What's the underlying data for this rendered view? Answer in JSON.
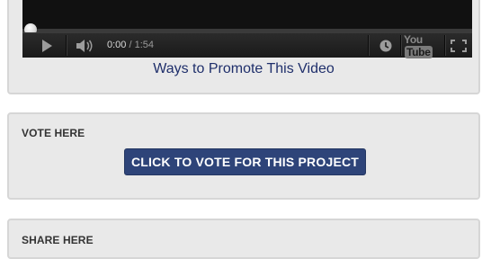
{
  "video": {
    "current_time": "0:00",
    "separator": "/",
    "duration": "1:54",
    "progress_fraction": 0.0,
    "title": "Ways to Promote This Video",
    "logo_text_left": "You",
    "logo_text_right": "Tube",
    "icons": [
      "play-icon",
      "volume-icon",
      "watch-later-icon",
      "youtube-logo",
      "fullscreen-icon"
    ]
  },
  "vote": {
    "heading": "VOTE HERE",
    "button_label": "CLICK TO VOTE FOR THIS PROJECT",
    "button_color": "#2e4479"
  },
  "share": {
    "heading": "SHARE HERE"
  }
}
